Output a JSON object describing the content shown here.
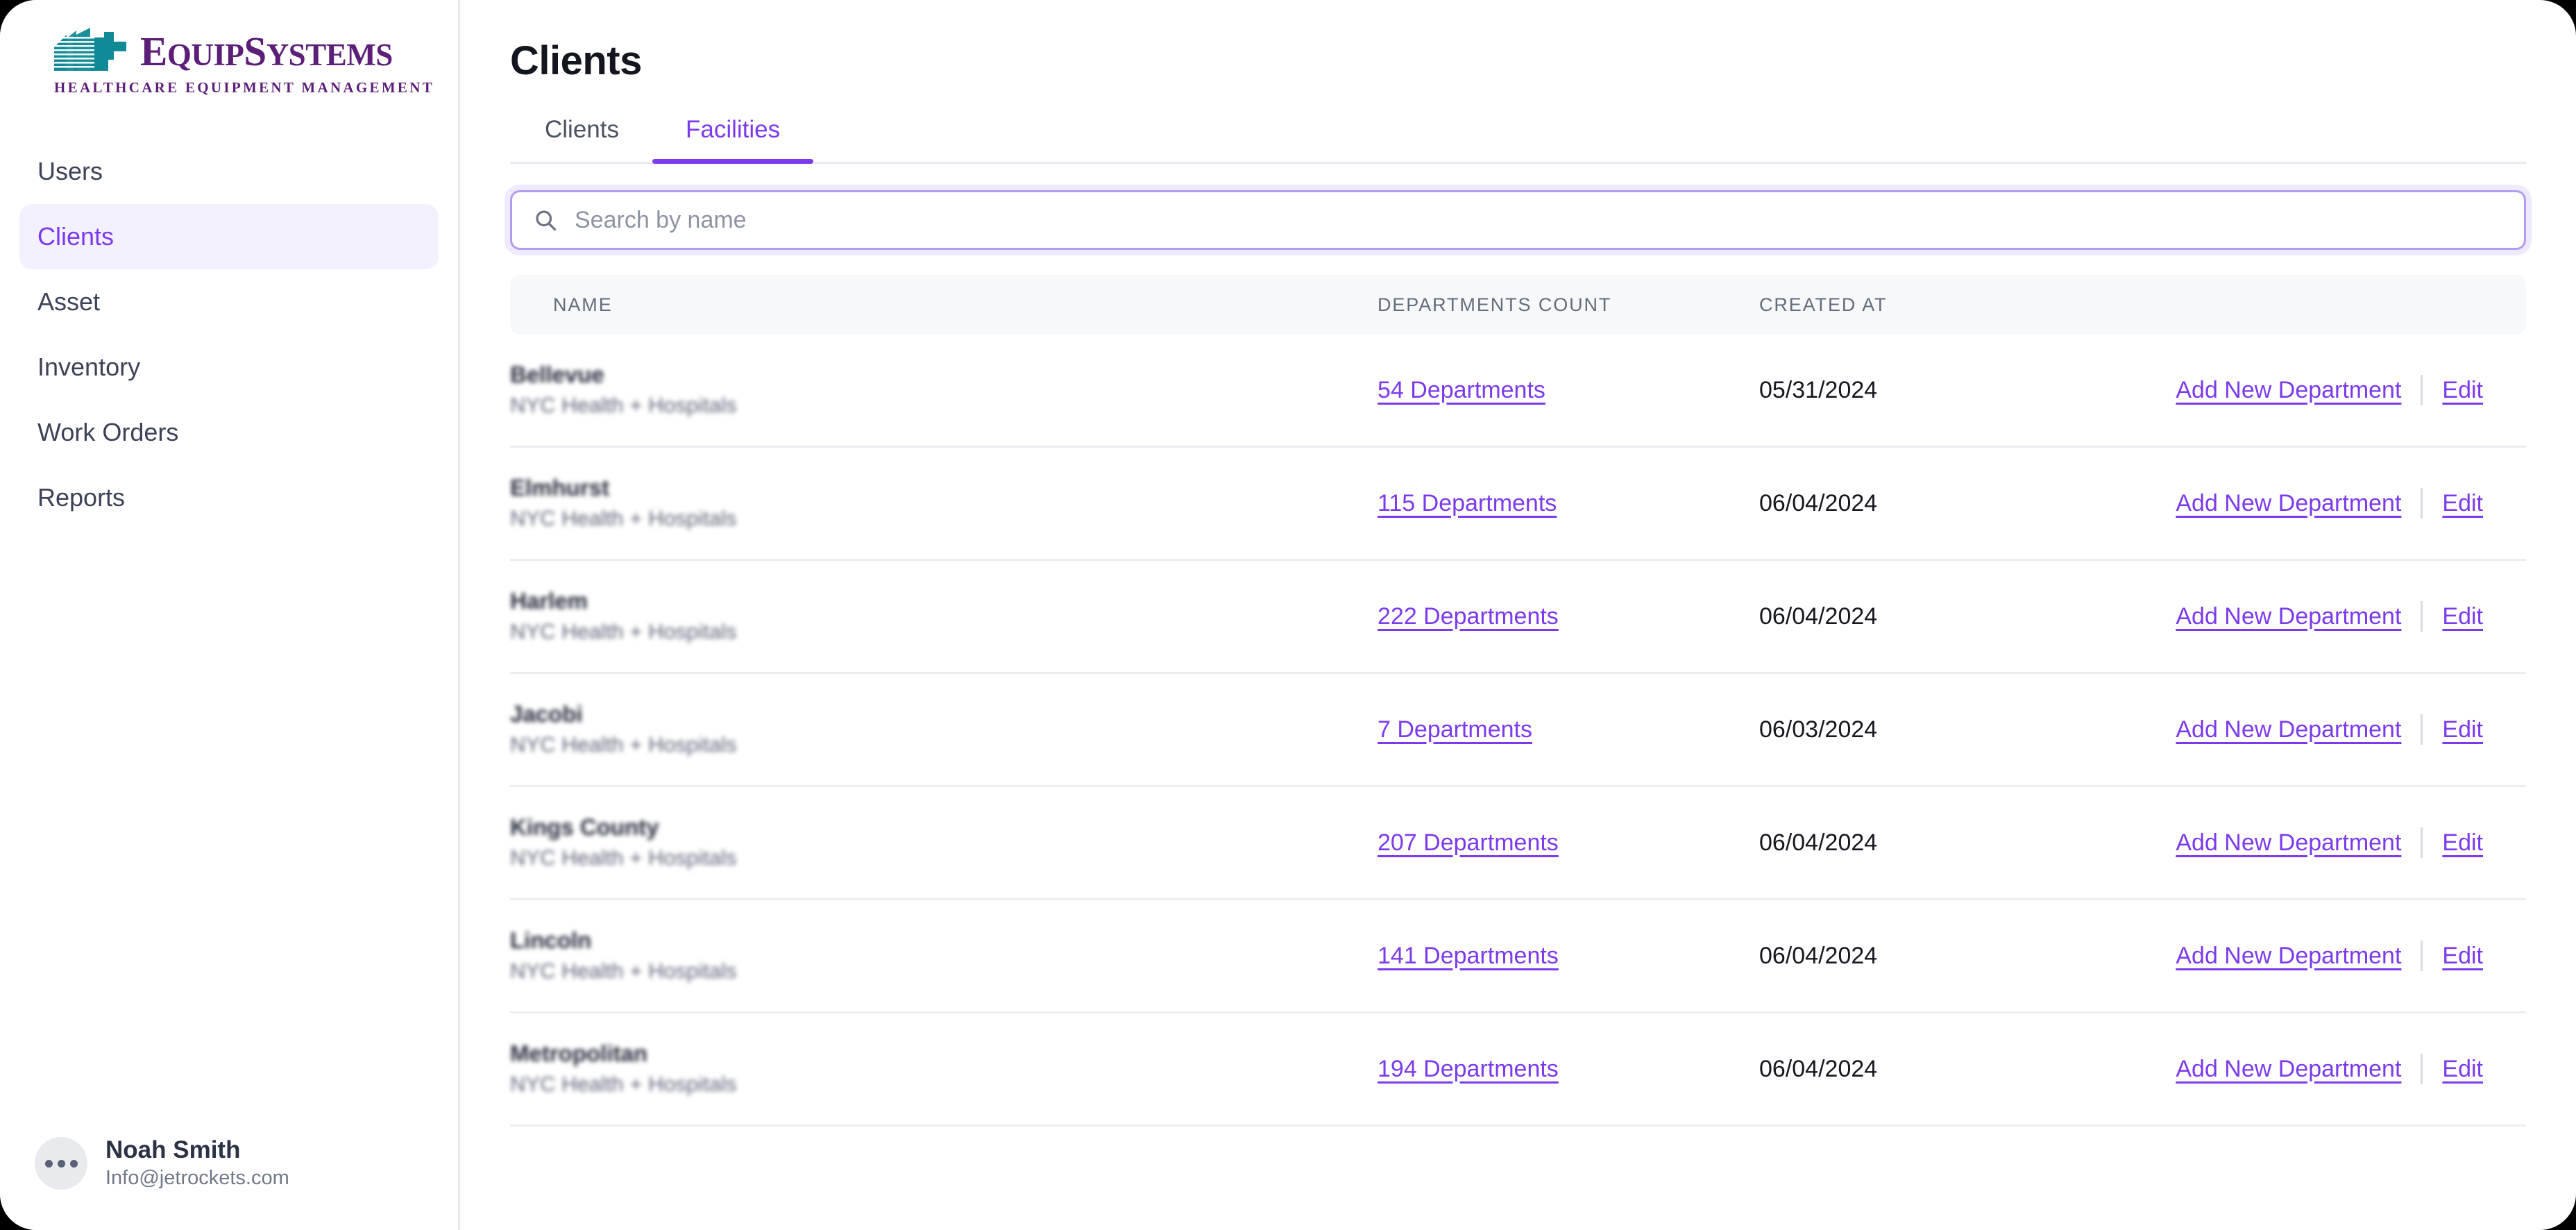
{
  "brand": {
    "name_part1": "E",
    "name_part2": "QUIP",
    "name_part3": "S",
    "name_part4": "YSTEMS",
    "tagline": "HEALTHCARE EQUIPMENT MANAGEMENT",
    "logo_icon": "stacked-building-logo"
  },
  "sidebar": {
    "items": [
      {
        "label": "Users",
        "active": false
      },
      {
        "label": "Clients",
        "active": true
      },
      {
        "label": "Asset",
        "active": false
      },
      {
        "label": "Inventory",
        "active": false
      },
      {
        "label": "Work Orders",
        "active": false
      },
      {
        "label": "Reports",
        "active": false
      }
    ],
    "profile": {
      "name": "Noah Smith",
      "email": "Info@jetrockets.com",
      "avatar_icon": "ellipsis-avatar"
    }
  },
  "main": {
    "page_title": "Clients",
    "tabs": [
      {
        "label": "Clients",
        "active": false
      },
      {
        "label": "Facilities",
        "active": true
      }
    ],
    "search": {
      "placeholder": "Search by name",
      "value": "",
      "icon": "search-icon"
    },
    "table": {
      "headers": {
        "name": "NAME",
        "departments_count": "DEPARTMENTS COUNT",
        "created_at": "CREATED AT"
      },
      "action_labels": {
        "add": "Add New Department",
        "edit": "Edit"
      },
      "rows": [
        {
          "name": "Bellevue",
          "org": "NYC Health + Hospitals",
          "departments": "54 Departments",
          "created_at": "05/31/2024"
        },
        {
          "name": "Elmhurst",
          "org": "NYC Health + Hospitals",
          "departments": "115 Departments",
          "created_at": "06/04/2024"
        },
        {
          "name": "Harlem",
          "org": "NYC Health + Hospitals",
          "departments": "222 Departments",
          "created_at": "06/04/2024"
        },
        {
          "name": "Jacobi",
          "org": "NYC Health + Hospitals",
          "departments": "7 Departments",
          "created_at": "06/03/2024"
        },
        {
          "name": "Kings County",
          "org": "NYC Health + Hospitals",
          "departments": "207 Departments",
          "created_at": "06/04/2024"
        },
        {
          "name": "Lincoln",
          "org": "NYC Health + Hospitals",
          "departments": "141 Departments",
          "created_at": "06/04/2024"
        },
        {
          "name": "Metropolitan",
          "org": "NYC Health + Hospitals",
          "departments": "194 Departments",
          "created_at": "06/04/2024"
        }
      ]
    }
  },
  "colors": {
    "accent_purple": "#7C3AED",
    "brand_purple": "#5C1E78",
    "brand_teal": "#0F8A96",
    "sidebar_active_bg": "#F4F1FE",
    "table_header_bg": "#F7F8FA",
    "border": "#E8E9EE"
  }
}
